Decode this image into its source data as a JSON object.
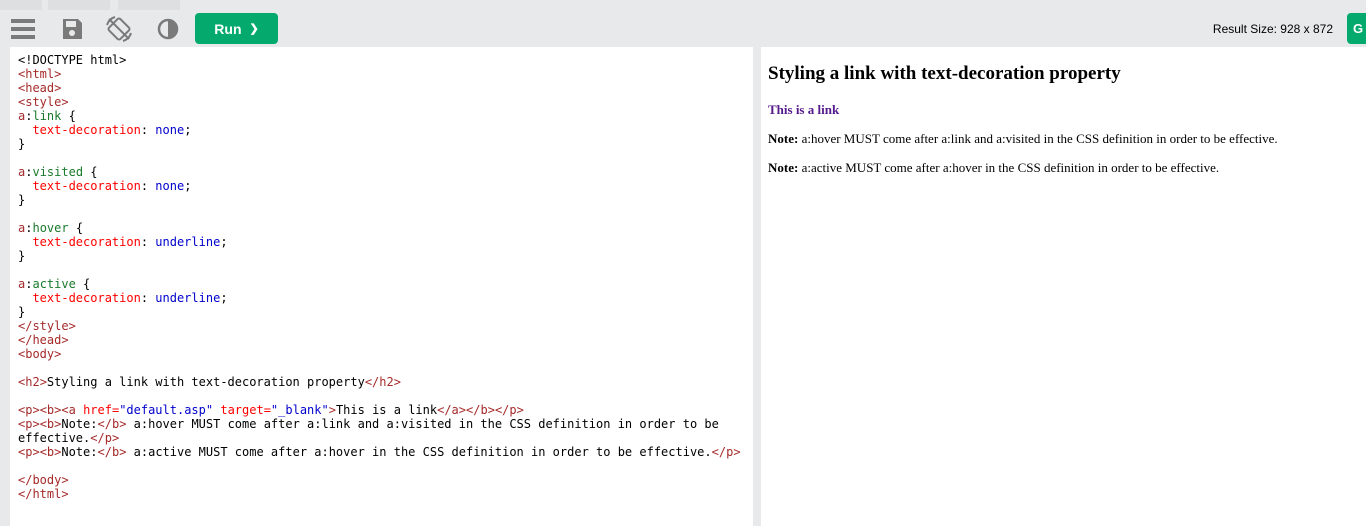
{
  "toolbar": {
    "menu_icon": "hamburger-menu-icon",
    "save_icon": "floppy-disk-icon",
    "rotate_icon": "rotate-layout-icon",
    "theme_icon": "contrast-icon",
    "run_label": "Run",
    "run_chevron": "❯",
    "result_size": "Result Size: 928 x 872",
    "get_label": "G"
  },
  "editor": {
    "lines": [
      "<!DOCTYPE html>",
      "<html>",
      "<head>",
      "<style>",
      "a:link {",
      "  text-decoration: none;",
      "}",
      "",
      "a:visited {",
      "  text-decoration: none;",
      "}",
      "",
      "a:hover {",
      "  text-decoration: underline;",
      "}",
      "",
      "a:active {",
      "  text-decoration: underline;",
      "}",
      "</style>",
      "</head>",
      "<body>",
      "",
      "<h2>Styling a link with text-decoration property</h2>",
      "",
      "<p><b><a href=\"default.asp\" target=\"_blank\">This is a link</a></b></p>",
      "<p><b>Note:</b> a:hover MUST come after a:link and a:visited in the CSS definition in order to be",
      "effective.</p>",
      "<p><b>Note:</b> a:active MUST come after a:hover in the CSS definition in order to be effective.</p>",
      "",
      "</body>",
      "</html>"
    ]
  },
  "result": {
    "heading": "Styling a link with text-decoration property",
    "link_text": "This is a link",
    "note1_label": "Note:",
    "note1_text": " a:hover MUST come after a:link and a:visited in the CSS definition in order to be effective.",
    "note2_label": "Note:",
    "note2_text": " a:active MUST come after a:hover in the CSS definition in order to be effective."
  },
  "colors": {
    "run_button": "#04aa6d",
    "link_visited": "#551a8b",
    "tag": "#a52a2a",
    "attr": "#ff0000",
    "value": "#0000cd",
    "selector_pseudo": "#1a7a2c"
  }
}
